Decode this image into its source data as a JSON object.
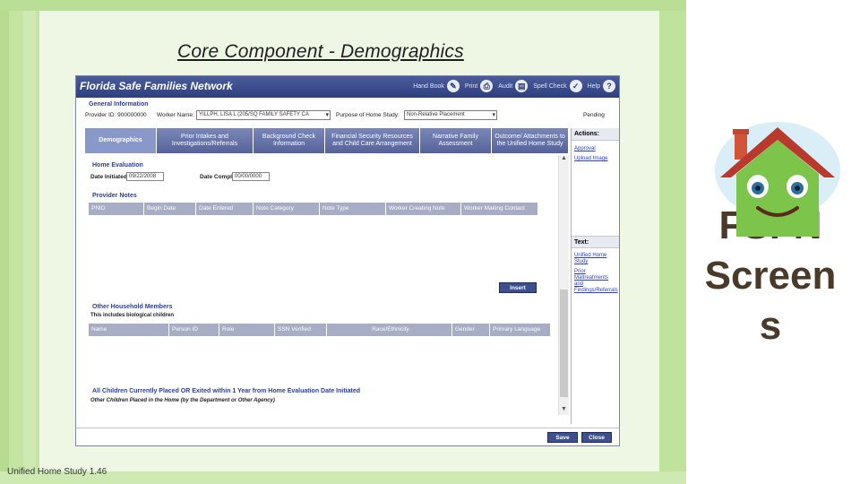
{
  "slide": {
    "title": "Core Component - Demographics",
    "footer": "Unified Home Study 1.46",
    "side_text_line1": "FSFN",
    "side_text_line2": "Screen",
    "side_text_line3": "s"
  },
  "app": {
    "title": "Florida Safe Families Network",
    "toolbar": [
      {
        "label": "Hand Book",
        "icon": "pencil-icon"
      },
      {
        "label": "Print",
        "icon": "print-icon"
      },
      {
        "label": "Audit",
        "icon": "audit-icon"
      },
      {
        "label": "Spell Check",
        "icon": "spellcheck-icon"
      },
      {
        "label": "Help",
        "icon": "help-icon"
      }
    ]
  },
  "general": {
    "header": "General Information",
    "provider_id": "Provider ID: 900000000",
    "worker_name_label": "Worker Name:",
    "worker_name_value": "YILLPH, LISA L (205/SQ FAMILY SAFETY CA",
    "purpose_label": "Purpose of Home Study:",
    "purpose_value": "Non-Relative Placement",
    "status": "Pending"
  },
  "tabs": [
    "Demographics",
    "Prior Intakes and Investigations/Referrals",
    "Background Check Information",
    "Financial Security Resources and Child Care Arrangement",
    "Narrative Family Assessment",
    "Outcome/ Attachments to the Unified Home Study"
  ],
  "actions": {
    "header": "Actions:",
    "links": [
      "Approval",
      "Upload Image"
    ],
    "text_header": "Text:",
    "text_links": [
      "Unified Home Study",
      "Prior Maltreatments and Findings/Referrals"
    ]
  },
  "home_eval": {
    "header": "Home Evaluation",
    "date_initiated_label": "Date Initiated:",
    "date_initiated_value": "09/22/2008",
    "date_completed_label": "Date Completed:",
    "date_completed_value": "00/00/0000"
  },
  "provider_notes": {
    "header": "Provider Notes",
    "columns": [
      "PNID",
      "Begin Date",
      "Date Entered",
      "Note Category",
      "Note Type",
      "Worker Creating Note",
      "Worker Making Contact"
    ],
    "insert_label": "Insert"
  },
  "household": {
    "header": "Other Household Members",
    "subheader": "This includes biological children",
    "columns": [
      "Name",
      "Person ID",
      "Role",
      "SSN Verified",
      "Race/Ethnicity",
      "Gender",
      "Primary Language"
    ]
  },
  "placed": {
    "header": "All Children Currently Placed OR Exited within 1 Year from Home Evaluation Date Initiated",
    "subheader": "Other Children Placed in the Home (by the Department or Other Agency)"
  },
  "buttons": {
    "save": "Save",
    "close": "Close"
  }
}
